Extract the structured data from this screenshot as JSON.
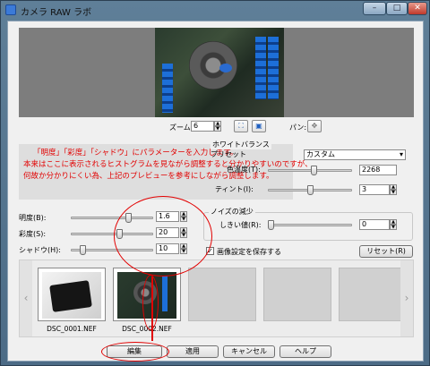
{
  "window": {
    "title": "カメラ RAW ラボ",
    "controls": [
      "minimize-icon",
      "maximize-icon",
      "close-icon"
    ]
  },
  "zoom": {
    "label": "ズーム:",
    "value": "6",
    "pan_label": "パン:"
  },
  "annotation": {
    "lines": [
      "「明度」「彩度」「シャドウ」にパラメーターを入力します。",
      "本来はここに表示されるヒストグラムを見ながら調整すると分かりやすいのですが、",
      "何故か分かりにくい為、上記のプレビューを参考にしながら調整します。"
    ],
    "color": "#e20000"
  },
  "white_balance": {
    "title": "ホワイトバランス",
    "preset_label": "プリセット",
    "preset_value": "カスタム",
    "color_temp_label": "色温度(T):",
    "color_temp_value": "2268",
    "tint_label": "ティント(I):",
    "tint_value": "3",
    "color_temp_level": 0.55,
    "tint_level": 0.5
  },
  "adjustments": {
    "brightness": {
      "label": "明度(B):",
      "value": "1.6",
      "level": 0.72
    },
    "saturation": {
      "label": "彩度(S):",
      "value": "20",
      "level": 0.6
    },
    "shadow": {
      "label": "シャドウ(H):",
      "value": "10",
      "level": 0.12
    }
  },
  "noise_reduction": {
    "title": "ノイズの減少",
    "threshold_label": "しきい値(R):",
    "threshold_value": "0",
    "threshold_level": 0.0
  },
  "save_settings": {
    "label": "画像設定を保存する",
    "checked": true
  },
  "reset_label": "リセット(R)",
  "filmstrip": {
    "items": [
      {
        "caption": "DSC_0001.NEF"
      },
      {
        "caption": "DSC_0002.NEF"
      }
    ]
  },
  "buttons": {
    "edit": "編集",
    "apply": "適用",
    "cancel": "キャンセル",
    "help": "ヘルプ"
  }
}
